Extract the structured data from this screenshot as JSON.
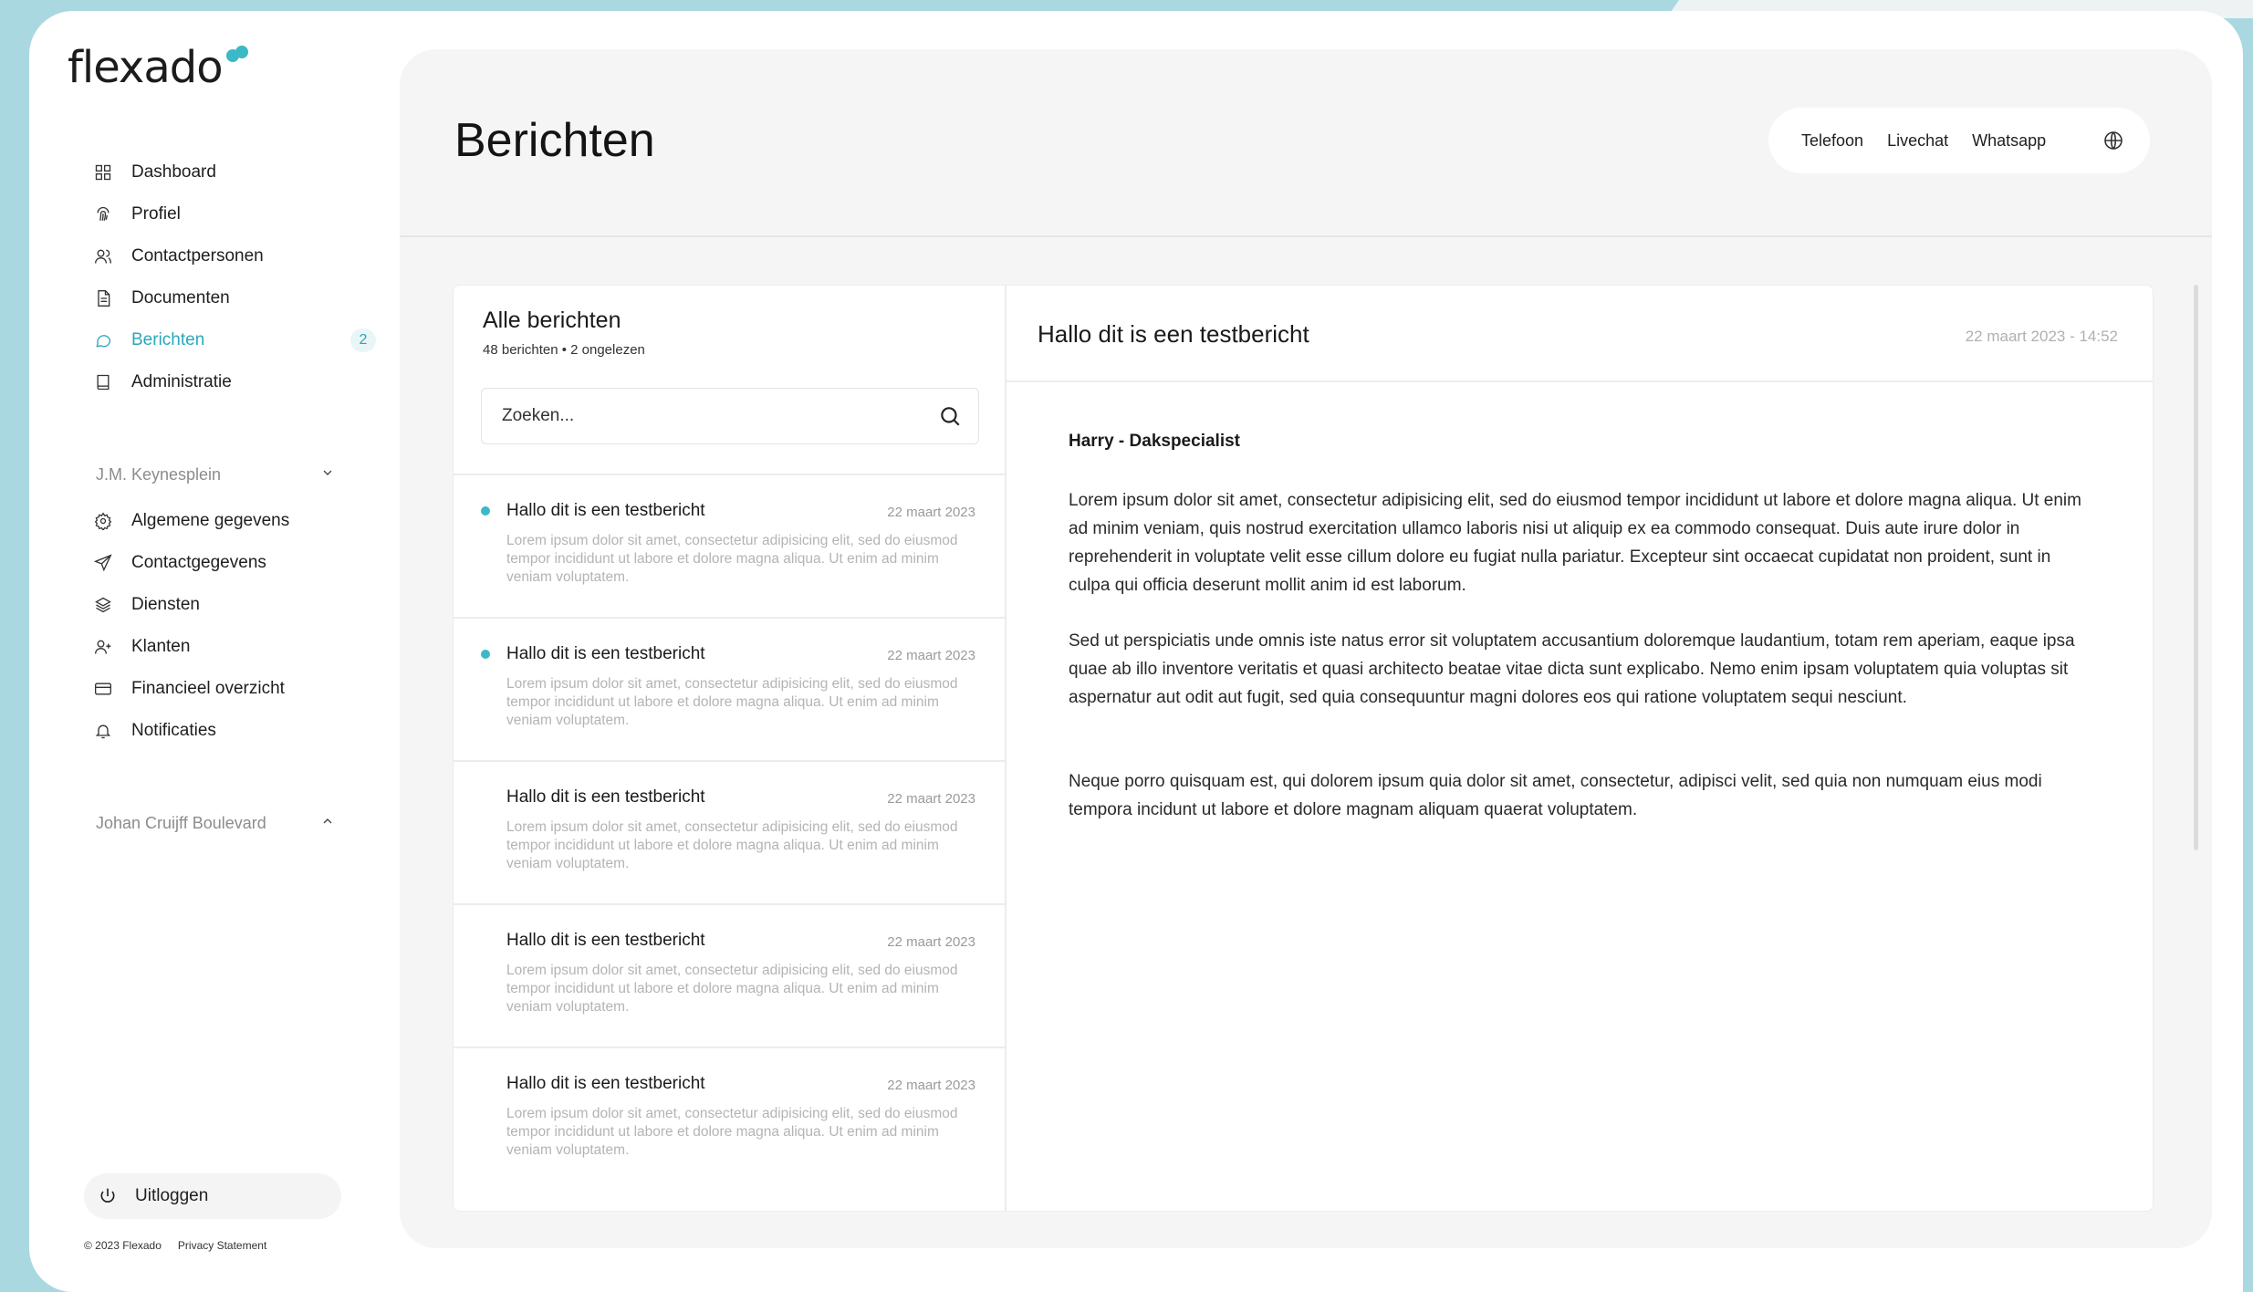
{
  "brand": {
    "logo_text": "flexado",
    "accent": "#3bb9c6",
    "background": "#a9d8e1"
  },
  "sidebar": {
    "items": [
      {
        "label": "Dashboard",
        "icon": "grid-icon"
      },
      {
        "label": "Profiel",
        "icon": "fingerprint-icon"
      },
      {
        "label": "Contactpersonen",
        "icon": "users-icon"
      },
      {
        "label": "Documenten",
        "icon": "document-icon"
      },
      {
        "label": "Berichten",
        "icon": "message-icon",
        "badge": "2",
        "active": true
      },
      {
        "label": "Administratie",
        "icon": "book-icon"
      }
    ],
    "group1": {
      "title": "J.M. Keynesplein",
      "expanded": true,
      "items": [
        {
          "label": "Algemene gegevens",
          "icon": "gear-icon"
        },
        {
          "label": "Contactgegevens",
          "icon": "send-icon"
        },
        {
          "label": "Diensten",
          "icon": "layers-icon"
        },
        {
          "label": "Klanten",
          "icon": "user-plus-icon"
        },
        {
          "label": "Financieel overzicht",
          "icon": "card-icon"
        },
        {
          "label": "Notificaties",
          "icon": "bell-icon"
        }
      ]
    },
    "group2": {
      "title": "Johan Cruijff Boulevard",
      "expanded": false
    },
    "logout_label": "Uitloggen",
    "copyright": "© 2023 Flexado",
    "privacy": "Privacy Statement"
  },
  "header": {
    "title": "Berichten",
    "links": [
      "Telefoon",
      "Livechat",
      "Whatsapp"
    ]
  },
  "list": {
    "title": "Alle berichten",
    "subtitle": "48 berichten • 2 ongelezen",
    "search_placeholder": "Zoeken...",
    "messages": [
      {
        "title": "Hallo dit is een testbericht",
        "date": "22 maart 2023",
        "unread": true,
        "preview": "Lorem ipsum dolor sit amet, consectetur adipisicing elit, sed do eiusmod tempor incididunt ut labore et dolore magna aliqua. Ut enim ad minim veniam voluptatem."
      },
      {
        "title": "Hallo dit is een testbericht",
        "date": "22 maart 2023",
        "unread": true,
        "preview": "Lorem ipsum dolor sit amet, consectetur adipisicing elit, sed do eiusmod tempor incididunt ut labore et dolore magna aliqua. Ut enim ad minim veniam voluptatem."
      },
      {
        "title": "Hallo dit is een testbericht",
        "date": "22 maart 2023",
        "unread": false,
        "preview": "Lorem ipsum dolor sit amet, consectetur adipisicing elit, sed do eiusmod tempor incididunt ut labore et dolore magna aliqua. Ut enim ad minim veniam voluptatem."
      },
      {
        "title": "Hallo dit is een testbericht",
        "date": "22 maart 2023",
        "unread": false,
        "preview": "Lorem ipsum dolor sit amet, consectetur adipisicing elit, sed do eiusmod tempor incididunt ut labore et dolore magna aliqua. Ut enim ad minim veniam voluptatem."
      },
      {
        "title": "Hallo dit is een testbericht",
        "date": "22 maart 2023",
        "unread": false,
        "preview": "Lorem ipsum dolor sit amet, consectetur adipisicing elit, sed do eiusmod tempor incididunt ut labore et dolore magna aliqua. Ut enim ad minim veniam voluptatem."
      }
    ]
  },
  "detail": {
    "title": "Hallo dit is een testbericht",
    "date": "22 maart 2023 - 14:52",
    "sender": "Harry - Dakspecialist",
    "paragraphs": [
      "Lorem ipsum dolor sit amet, consectetur adipisicing elit, sed do eiusmod tempor incididunt ut labore et dolore magna aliqua. Ut enim ad minim veniam, quis nostrud exercitation ullamco laboris nisi ut aliquip ex ea commodo consequat. Duis aute irure dolor in reprehenderit in voluptate velit esse cillum dolore eu fugiat nulla pariatur. Excepteur sint occaecat cupidatat non proident, sunt in culpa qui officia deserunt mollit anim id est laborum.",
      "Sed ut perspiciatis unde omnis iste natus error sit voluptatem accusantium doloremque laudantium, totam rem aperiam, eaque ipsa quae ab illo inventore veritatis et quasi architecto beatae vitae dicta sunt explicabo. Nemo enim ipsam voluptatem quia voluptas sit aspernatur aut odit aut fugit, sed quia consequuntur magni dolores eos qui ratione voluptatem sequi nesciunt.",
      "Neque porro quisquam est, qui dolorem ipsum quia dolor sit amet, consectetur, adipisci velit, sed quia non numquam eius modi tempora incidunt ut labore et dolore magnam aliquam quaerat voluptatem."
    ]
  }
}
